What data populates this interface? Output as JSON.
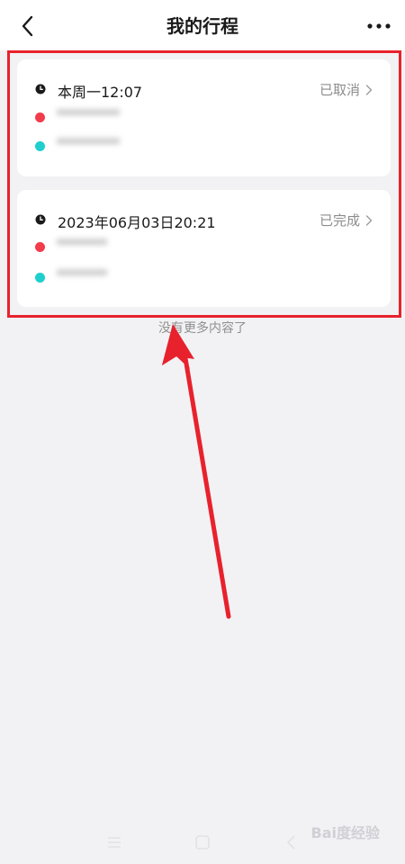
{
  "header": {
    "title": "我的行程",
    "back_icon": "chevron-left-icon",
    "more_icon": "more-dots-icon"
  },
  "trips": [
    {
      "time": "本周一12:07",
      "status": "已取消",
      "origin": "**********",
      "destination": "**********"
    },
    {
      "time": "2023年06月03日20:21",
      "status": "已完成",
      "origin": "********",
      "destination": "********"
    }
  ],
  "footer": {
    "no_more": "没有更多内容了"
  },
  "watermark": {
    "text": "Bai度经验"
  },
  "colors": {
    "origin_dot": "#f23c4b",
    "destination_dot": "#1ecfce",
    "annotation": "#e8222d",
    "background": "#f2f2f4"
  }
}
